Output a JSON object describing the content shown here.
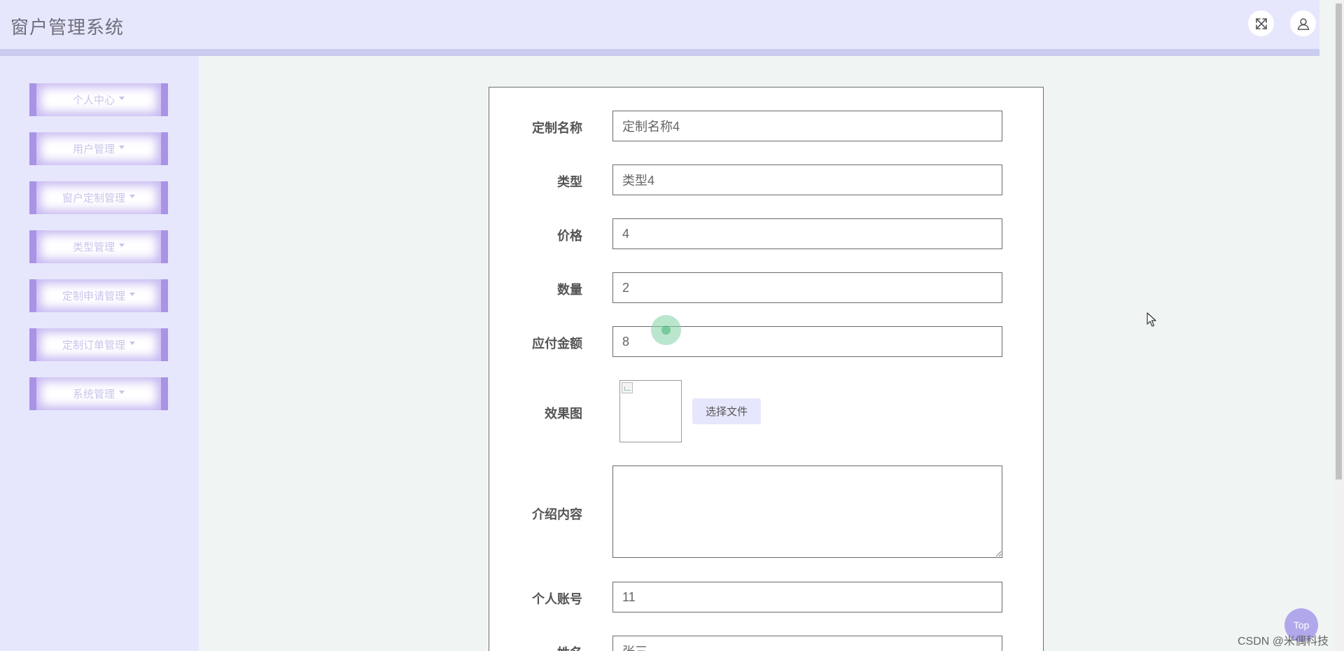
{
  "header": {
    "title": "窗户管理系统",
    "fullscreen_icon": "expand-arrows-icon",
    "user_icon": "user-icon"
  },
  "sidebar": {
    "items": [
      {
        "label": "个人中心"
      },
      {
        "label": "用户管理"
      },
      {
        "label": "窗户定制管理"
      },
      {
        "label": "类型管理"
      },
      {
        "label": "定制申请管理"
      },
      {
        "label": "定制订单管理"
      },
      {
        "label": "系统管理"
      }
    ]
  },
  "form": {
    "custom_name": {
      "label": "定制名称",
      "value": "定制名称4"
    },
    "type": {
      "label": "类型",
      "value": "类型4"
    },
    "price": {
      "label": "价格",
      "value": "4"
    },
    "quantity": {
      "label": "数量",
      "value": "2"
    },
    "amount_due": {
      "label": "应付金额",
      "value": "8"
    },
    "effect_image": {
      "label": "效果图",
      "button_label": "选择文件"
    },
    "intro": {
      "label": "介绍内容",
      "value": ""
    },
    "account": {
      "label": "个人账号",
      "value": "11"
    },
    "name": {
      "label": "姓名",
      "value": "张三"
    }
  },
  "back_to_top_label": "Top",
  "watermark": "CSDN @米偶科技",
  "colors": {
    "header_bg": "#e6e7fc",
    "menu_accent": "#a993e6",
    "page_bg": "#f0f5f4",
    "top_button": "#b1a8ec"
  }
}
